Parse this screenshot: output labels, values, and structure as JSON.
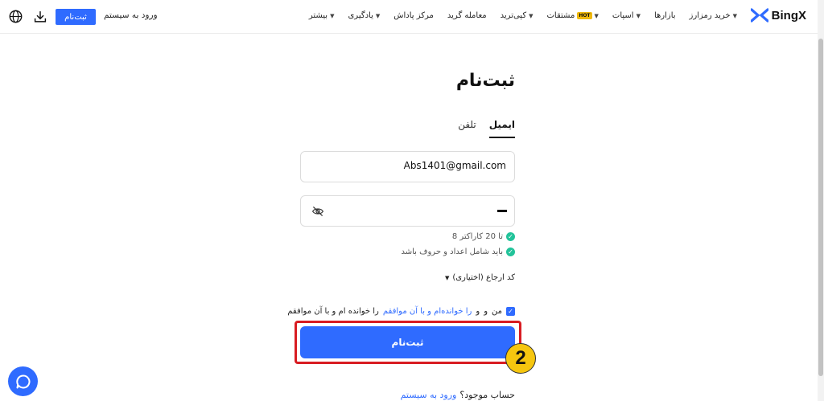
{
  "header": {
    "signup_label": "ثبت‌نام",
    "login_label": "ورود به سیستم",
    "brand": "BingX",
    "nav": [
      {
        "label": "خرید رمزارز",
        "caret": true
      },
      {
        "label": "بازارها",
        "caret": false
      },
      {
        "label": "اسپات",
        "caret": true
      },
      {
        "label": "مشتقات",
        "caret": true,
        "badge": "HOT"
      },
      {
        "label": "کپی‌ترید",
        "caret": true
      },
      {
        "label": "معامله گرید",
        "caret": false
      },
      {
        "label": "مرکز پاداش",
        "caret": false
      },
      {
        "label": "یادگیری",
        "caret": true
      },
      {
        "label": "بیشتر",
        "caret": true
      }
    ]
  },
  "form": {
    "title": "ثبت‌نام",
    "tabs": [
      "ایمیل",
      "تلفن"
    ],
    "email_value": "Abs1401@gmail.com",
    "rules": [
      "8 تا 20 کاراکتر",
      "باید شامل اعداد و حروف باشد"
    ],
    "referral_label": "کد ارجاع (اختیاری)",
    "agree": {
      "prefix": "من",
      "w1": "و",
      "w2": "و",
      "link": "را خوانده‌ام و با آن موافقم",
      "suffix": "را خوانده ام و با آن موافقم"
    },
    "submit_label": "ثبت‌نام",
    "step_number": "2",
    "account_question": "حساب موجود؟",
    "login_link": "ورود به سیستم"
  },
  "colors": {
    "accent": "#2f6bff",
    "highlight": "#d81c22",
    "step": "#f6c60f",
    "success": "#22c39a"
  }
}
